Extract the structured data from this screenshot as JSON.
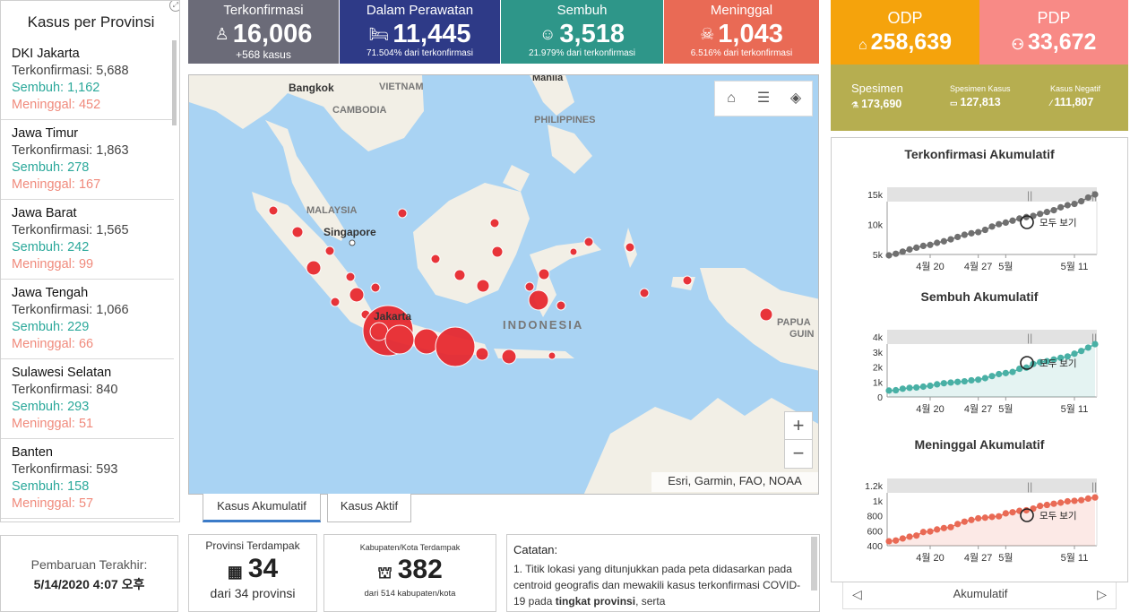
{
  "provinces": {
    "title": "Kasus per Provinsi",
    "items": [
      {
        "name": "DKI Jakarta",
        "confirmed": "Terkonfirmasi: 5,688",
        "recovered": "Sembuh: 1,162",
        "deaths": "Meninggal: 452"
      },
      {
        "name": "Jawa Timur",
        "confirmed": "Terkonfirmasi: 1,863",
        "recovered": "Sembuh: 278",
        "deaths": "Meninggal: 167"
      },
      {
        "name": "Jawa Barat",
        "confirmed": "Terkonfirmasi: 1,565",
        "recovered": "Sembuh: 242",
        "deaths": "Meninggal: 99"
      },
      {
        "name": "Jawa Tengah",
        "confirmed": "Terkonfirmasi: 1,066",
        "recovered": "Sembuh: 229",
        "deaths": "Meninggal: 66"
      },
      {
        "name": "Sulawesi Selatan",
        "confirmed": "Terkonfirmasi: 840",
        "recovered": "Sembuh: 293",
        "deaths": "Meninggal: 51"
      },
      {
        "name": "Banten",
        "confirmed": "Terkonfirmasi: 593",
        "recovered": "Sembuh: 158",
        "deaths": "Meninggal: 57"
      }
    ]
  },
  "stats": {
    "confirmed": {
      "label": "Terkonfirmasi",
      "value": "16,006",
      "sub": "+568 kasus",
      "color": "#6b6b78"
    },
    "treated": {
      "label": "Dalam Perawatan",
      "value": "11,445",
      "sub": "71.504% dari terkonfirmasi",
      "color": "#2e3a87"
    },
    "recovered": {
      "label": "Sembuh",
      "value": "3,518",
      "sub": "21.979% dari terkonfirmasi",
      "color": "#2e9689"
    },
    "deaths": {
      "label": "Meninggal",
      "value": "1,043",
      "sub": "6.516% dari terkonfirmasi",
      "color": "#e96a55"
    }
  },
  "odp": {
    "label": "ODP",
    "value": "258,639"
  },
  "pdp": {
    "label": "PDP",
    "value": "33,672"
  },
  "specimen": {
    "label": "Spesimen",
    "value": "173,690",
    "cases_label": "Spesimen Kasus",
    "cases_value": "127,813",
    "negative_label": "Kasus Negatif",
    "negative_value": "111,807"
  },
  "map": {
    "labels": [
      "Bangkok",
      "VIETNAM",
      "CAMBODIA",
      "Manila",
      "PHILIPPINES",
      "MALAYSIA",
      "Singapore",
      "INDONESIA",
      "PAPUA",
      "GUIN",
      "Jakarta"
    ],
    "attribution": "Esri, Garmin, FAO, NOAA",
    "zoom_in": "+",
    "zoom_out": "−"
  },
  "tabs": {
    "cumulative": "Kasus Akumulatif",
    "active": "Kasus Aktif"
  },
  "update": {
    "label": "Pembaruan Terakhir:",
    "value": "5/14/2020 4:07 오후"
  },
  "affected_provinces": {
    "label": "Provinsi Terdampak",
    "value": "34",
    "sub": "dari 34 provinsi"
  },
  "affected_regencies": {
    "label": "Kabupaten/Kota Terdampak",
    "value": "382",
    "sub": "dari 514 kabupaten/kota"
  },
  "notes": {
    "title": "Catatan:",
    "text_a": "1. Titik lokasi yang ditunjukkan pada peta didasarkan pada centroid geografis dan mewakili kasus terkonfirmasi COVID-19 pada ",
    "text_bold": "tingkat provinsi",
    "text_b": ", serta"
  },
  "chart_footer": "Akumulatif",
  "reset_label": "모두 보기",
  "chart_data": [
    {
      "type": "line",
      "title": "Terkonfirmasi Akumulatif",
      "x_ticks": [
        "4월 20",
        "4월 27",
        "5월",
        "5월 11"
      ],
      "y_ticks": [
        "15k",
        "10k",
        "5k"
      ],
      "ylim": [
        5000,
        16000
      ],
      "color": "#707070",
      "x": [
        "4/14",
        "4/15",
        "4/16",
        "4/17",
        "4/18",
        "4/19",
        "4/20",
        "4/21",
        "4/22",
        "4/23",
        "4/24",
        "4/25",
        "4/26",
        "4/27",
        "4/28",
        "4/29",
        "4/30",
        "5/1",
        "5/2",
        "5/3",
        "5/4",
        "5/5",
        "5/6",
        "5/7",
        "5/8",
        "5/9",
        "5/10",
        "5/11",
        "5/12",
        "5/13",
        "5/14"
      ],
      "values": [
        4839,
        5136,
        5516,
        5923,
        6248,
        6575,
        6760,
        7135,
        7418,
        7775,
        8211,
        8607,
        8882,
        9096,
        9511,
        10118,
        10551,
        10843,
        11192,
        11587,
        11856,
        12071,
        12438,
        12776,
        13112,
        13645,
        14032,
        14265,
        14749,
        15438,
        16006
      ]
    },
    {
      "type": "area",
      "title": "Sembuh Akumulatif",
      "x_ticks": [
        "4월 20",
        "4월 27",
        "5월",
        "5월 11"
      ],
      "y_ticks": [
        "4k",
        "3k",
        "2k",
        "1k",
        "0"
      ],
      "ylim": [
        0,
        4000
      ],
      "color": "#49b0a5",
      "x": [
        "4/14",
        "4/15",
        "4/16",
        "4/17",
        "4/18",
        "4/19",
        "4/20",
        "4/21",
        "4/22",
        "4/23",
        "4/24",
        "4/25",
        "4/26",
        "4/27",
        "4/28",
        "4/29",
        "4/30",
        "5/1",
        "5/2",
        "5/3",
        "5/4",
        "5/5",
        "5/6",
        "5/7",
        "5/8",
        "5/9",
        "5/10",
        "5/11",
        "5/12",
        "5/13",
        "5/14"
      ],
      "values": [
        426,
        446,
        548,
        607,
        631,
        686,
        747,
        842,
        913,
        960,
        1002,
        1042,
        1107,
        1151,
        1254,
        1391,
        1522,
        1591,
        1665,
        1876,
        1954,
        2197,
        2317,
        2381,
        2494,
        2607,
        2698,
        2881,
        3063,
        3287,
        3518
      ]
    },
    {
      "type": "area",
      "title": "Meninggal Akumulatif",
      "x_ticks": [
        "4월 20",
        "4월 27",
        "5월",
        "5월 11"
      ],
      "y_ticks": [
        "1.2k",
        "1k",
        "800",
        "600",
        "400"
      ],
      "ylim": [
        400,
        1200
      ],
      "color": "#e96a55",
      "x": [
        "4/14",
        "4/15",
        "4/16",
        "4/17",
        "4/18",
        "4/19",
        "4/20",
        "4/21",
        "4/22",
        "4/23",
        "4/24",
        "4/25",
        "4/26",
        "4/27",
        "4/28",
        "4/29",
        "4/30",
        "5/1",
        "5/2",
        "5/3",
        "5/4",
        "5/5",
        "5/6",
        "5/7",
        "5/8",
        "5/9",
        "5/10",
        "5/11",
        "5/12",
        "5/13",
        "5/14"
      ],
      "values": [
        459,
        469,
        496,
        520,
        535,
        582,
        590,
        616,
        635,
        647,
        689,
        720,
        743,
        765,
        773,
        784,
        792,
        831,
        845,
        864,
        872,
        895,
        930,
        943,
        959,
        973,
        991,
        998,
        1007,
        1028,
        1043
      ]
    }
  ]
}
